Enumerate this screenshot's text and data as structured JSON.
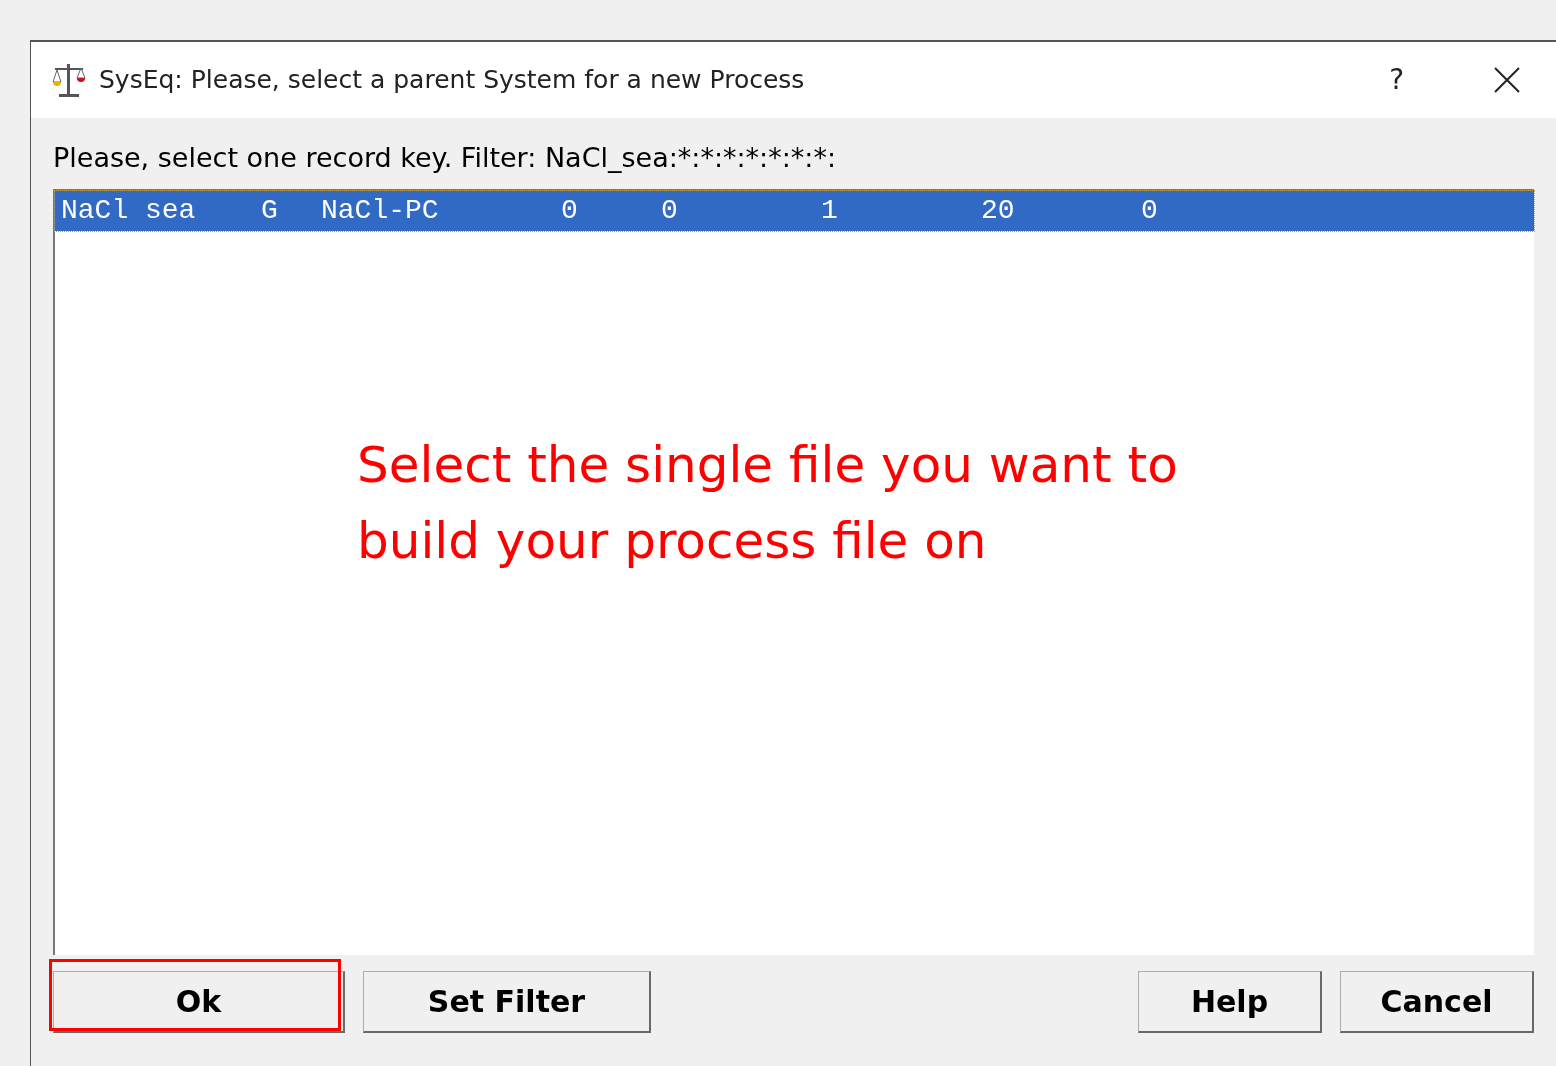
{
  "window": {
    "title": "SysEq: Please, select a parent System for a new Process",
    "help_glyph": "?"
  },
  "prompt": "Please, select one record key. Filter: NaCl_sea:*:*:*:*:*:*:*:",
  "rows": [
    {
      "selected": true,
      "cells": [
        "NaCl sea",
        "G",
        "NaCl-PC",
        "0",
        "0",
        "1",
        "20",
        "0"
      ]
    }
  ],
  "annotation": "Select the single file you want to build your process file on",
  "buttons": [
    {
      "label": "Ok",
      "highlighted": true
    },
    {
      "label": "Set Filter",
      "highlighted": false
    },
    {
      "label": "Help",
      "highlighted": false
    },
    {
      "label": "Cancel",
      "highlighted": false
    }
  ]
}
